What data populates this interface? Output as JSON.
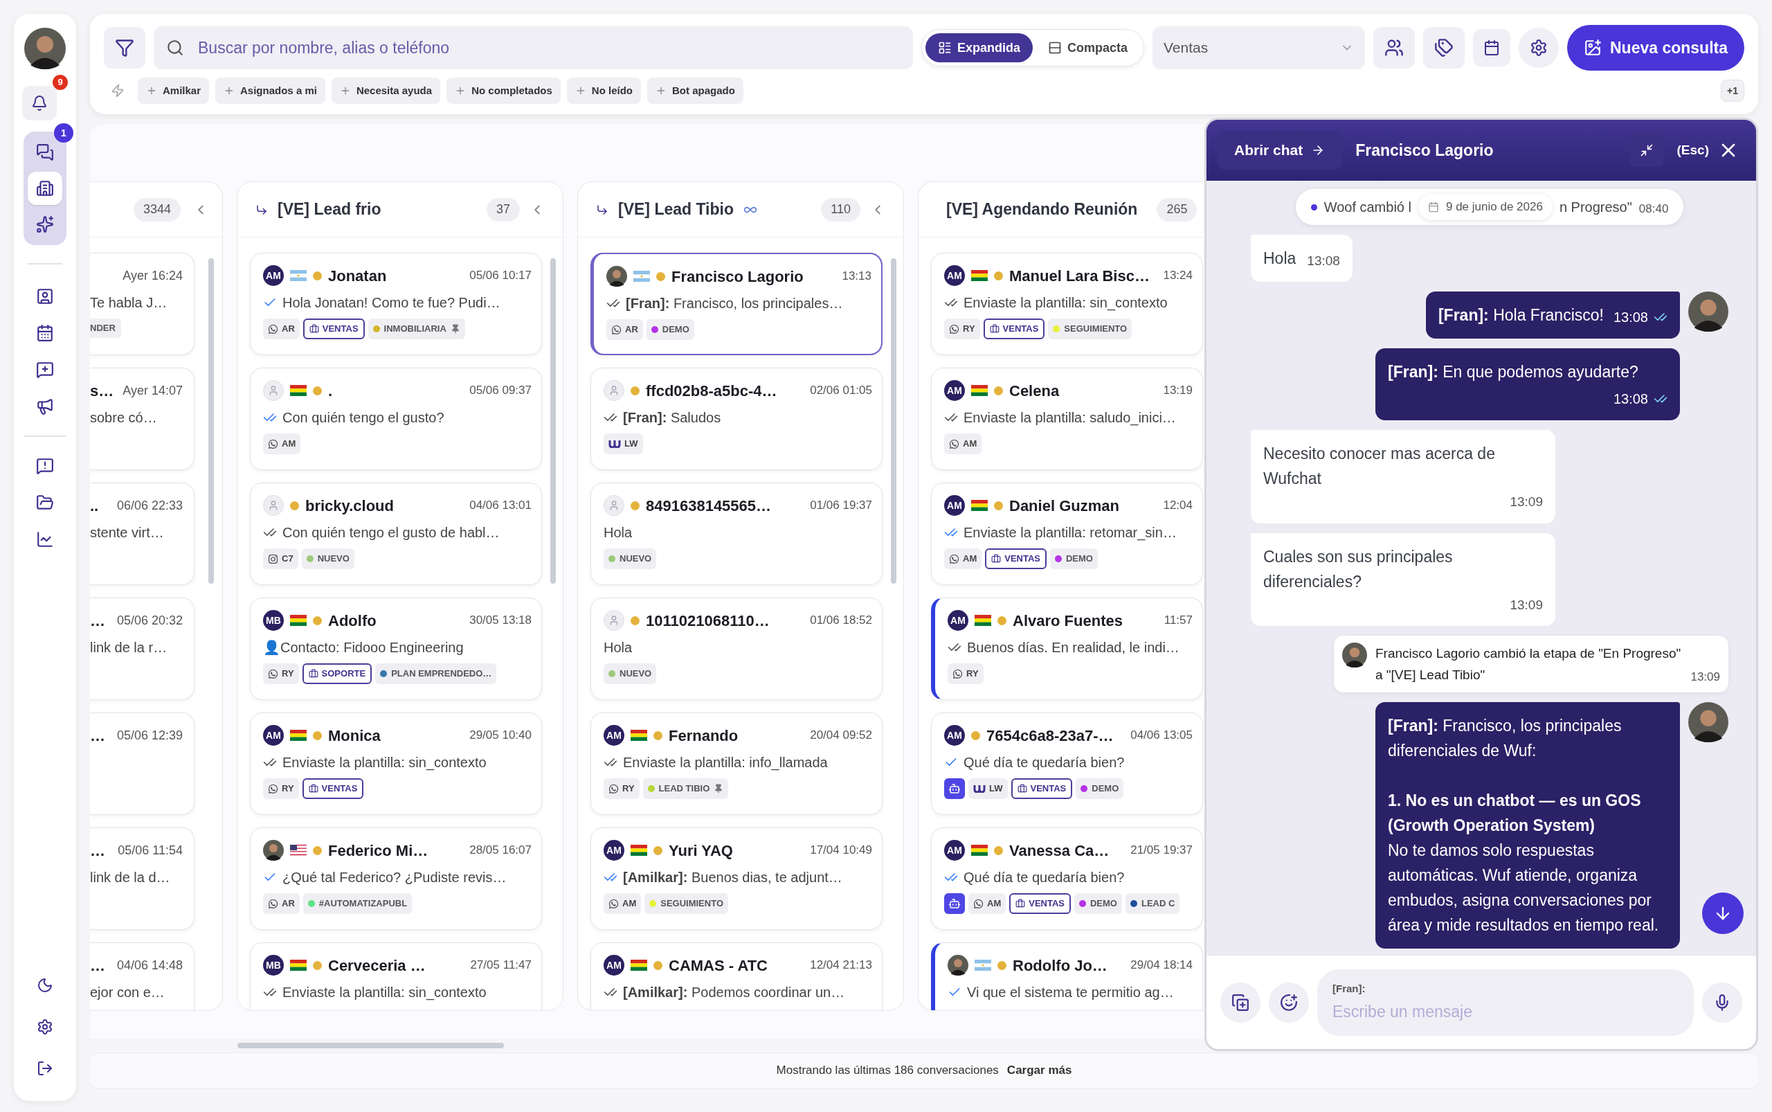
{
  "sidebar": {
    "bell_badge": "9",
    "groups": [
      {
        "kind": "active",
        "items": [
          {
            "selected": false,
            "badge": "1"
          },
          {
            "selected": true
          },
          {
            "selected": false
          }
        ]
      },
      {
        "kind": "plain",
        "items": [
          {
            "selected": false
          },
          {
            "selected": false
          },
          {
            "selected": false
          },
          {
            "selected": false
          }
        ]
      },
      {
        "kind": "plain",
        "items": [
          {
            "selected": false
          },
          {
            "selected": false
          },
          {
            "selected": false
          }
        ]
      }
    ]
  },
  "topbar": {
    "search": {
      "placeholder": "Buscar por nombre, alias o teléfono"
    },
    "view_modes": [
      {
        "label": "Expandida",
        "selected": true
      },
      {
        "label": "Compacta",
        "selected": false
      }
    ],
    "pipeline_select": {
      "value": "Ventas"
    },
    "new_button": "Nueva consulta",
    "quick_filters": [
      "Amilkar",
      "Asignados a mi",
      "Necesita ayuda",
      "No completados",
      "No leído",
      "Bot apagado"
    ],
    "more_badge": "+1"
  },
  "columns": [
    {
      "kind": "partial",
      "count": "3344",
      "collapsible": true,
      "cards": [
        {
          "time": "Ayer 16:24",
          "message": "Te habla J…",
          "tags": [
            {
              "kind": "plain",
              "text": "NDER"
            }
          ]
        },
        {
          "name": "s…",
          "time": "Ayer 14:07",
          "message": "sobre có…"
        },
        {
          "name": "..",
          "time": "06/06 22:33",
          "message": "stente virt…"
        },
        {
          "name": "…",
          "time": "05/06 20:32",
          "message": "link de la r…"
        },
        {
          "name": "…",
          "time": "05/06 12:39"
        },
        {
          "name": "…",
          "time": "05/06 11:54",
          "message": "link de la d…"
        },
        {
          "name": "…",
          "time": "04/06 14:48",
          "message": "ejor con e…"
        }
      ]
    },
    {
      "kind": "stage",
      "title": "[VE] Lead frio",
      "integration_icon": false,
      "count": "37",
      "collapsible": true,
      "cards": [
        {
          "avatar": {
            "kind": "initials",
            "text": "AM"
          },
          "flag": {
            "kind": "ar"
          },
          "name": "Jonatan",
          "time": "05/06 10:17",
          "receipt": {
            "kind": "sent"
          },
          "message": "Hola Jonatan! Como te fue? Pudi…",
          "selected": false,
          "accent_bar": false,
          "tags": [
            {
              "kind": "whatsapp",
              "text": "AR"
            },
            {
              "kind": "area",
              "text": "VENTAS"
            },
            {
              "kind": "label",
              "text": "INMOBILIARIA",
              "color": "#d4b52c",
              "pinned": true
            }
          ]
        },
        {
          "avatar": {
            "kind": "placeholder"
          },
          "flag": {
            "kind": "bo"
          },
          "name": ".",
          "time": "05/06 09:37",
          "receipt": {
            "kind": "read"
          },
          "message": "Con quién tengo el gusto?",
          "selected": false,
          "accent_bar": false,
          "tags": [
            {
              "kind": "whatsapp",
              "text": "AM"
            }
          ]
        },
        {
          "avatar": {
            "kind": "placeholder"
          },
          "name": "bricky.cloud",
          "time": "04/06 13:01",
          "receipt": {
            "kind": "delivered"
          },
          "message": "Con quién tengo el gusto de habl…",
          "selected": false,
          "accent_bar": false,
          "tags": [
            {
              "kind": "instagram",
              "text": "C7"
            },
            {
              "kind": "label",
              "text": "NUEVO",
              "color": "#9cc97a",
              "pinned": false
            }
          ]
        },
        {
          "avatar": {
            "kind": "initials",
            "text": "MB"
          },
          "flag": {
            "kind": "bo"
          },
          "name": "Adolfo",
          "time": "30/05 13:18",
          "message": "👤Contacto: Fidooo Engineering",
          "selected": false,
          "accent_bar": false,
          "tags": [
            {
              "kind": "whatsapp",
              "text": "RY"
            },
            {
              "kind": "area",
              "text": "SOPORTE"
            },
            {
              "kind": "label",
              "text": "PLAN EMPRENDEDO…",
              "color": "#3a78a8",
              "pinned": false
            }
          ]
        },
        {
          "avatar": {
            "kind": "initials",
            "text": "AM"
          },
          "flag": {
            "kind": "bo"
          },
          "name": "Monica",
          "time": "29/05 10:40",
          "receipt": {
            "kind": "delivered"
          },
          "message": "Enviaste la plantilla: sin_contexto",
          "selected": false,
          "accent_bar": false,
          "tags": [
            {
              "kind": "whatsapp",
              "text": "RY"
            },
            {
              "kind": "area",
              "text": "VENTAS"
            }
          ]
        },
        {
          "avatar": {
            "kind": "photo"
          },
          "flag": {
            "kind": "us"
          },
          "name": "Federico Mi…",
          "time": "28/05 16:07",
          "receipt": {
            "kind": "sent"
          },
          "message": "¿Qué tal Federico? ¿Pudiste revis…",
          "selected": false,
          "accent_bar": false,
          "tags": [
            {
              "kind": "whatsapp",
              "text": "AR"
            },
            {
              "kind": "label",
              "text": "#AUTOMATIZAPUBL",
              "color": "#5ee38a",
              "pinned": false
            }
          ]
        },
        {
          "avatar": {
            "kind": "initials",
            "text": "MB"
          },
          "flag": {
            "kind": "bo"
          },
          "name": "Cerveceria …",
          "time": "27/05 11:47",
          "receipt": {
            "kind": "delivered"
          },
          "message": "Enviaste la plantilla: sin_contexto",
          "selected": false,
          "accent_bar": false
        }
      ]
    },
    {
      "kind": "stage",
      "title": "[VE] Lead Tibio",
      "integration_icon": true,
      "count": "110",
      "collapsible": true,
      "cards": [
        {
          "avatar": {
            "kind": "photo"
          },
          "flag": {
            "kind": "ar"
          },
          "name": "Francisco Lagorio",
          "time": "13:13",
          "receipt": {
            "kind": "delivered"
          },
          "message": "**[Fran]:** Francisco, los principales…",
          "selected": true,
          "accent_bar": false,
          "tags": [
            {
              "kind": "whatsapp",
              "text": "AR"
            },
            {
              "kind": "label",
              "text": "DEMO",
              "color": "#b532e6",
              "pinned": false
            }
          ]
        },
        {
          "avatar": {
            "kind": "placeholder"
          },
          "name": "ffcd02b8-a5bc-4…",
          "time": "02/06 01:05",
          "receipt": {
            "kind": "delivered"
          },
          "message": "**[Fran]:** Saludos",
          "selected": false,
          "accent_bar": false,
          "tags": [
            {
              "kind": "web",
              "text": "LW"
            }
          ]
        },
        {
          "avatar": {
            "kind": "placeholder"
          },
          "name": "8491638145565…",
          "time": "01/06 19:37",
          "message": "Hola",
          "selected": false,
          "accent_bar": false,
          "tags": [
            {
              "kind": "label",
              "text": "NUEVO",
              "color": "#9cc97a",
              "pinned": false
            }
          ]
        },
        {
          "avatar": {
            "kind": "placeholder"
          },
          "name": "1011021068110…",
          "time": "01/06 18:52",
          "message": "Hola",
          "selected": false,
          "accent_bar": false,
          "tags": [
            {
              "kind": "label",
              "text": "NUEVO",
              "color": "#9cc97a",
              "pinned": false
            }
          ]
        },
        {
          "avatar": {
            "kind": "initials",
            "text": "AM"
          },
          "flag": {
            "kind": "bo"
          },
          "name": "Fernando",
          "time": "20/04 09:52",
          "receipt": {
            "kind": "delivered"
          },
          "message": "Enviaste la plantilla: info_llamada",
          "selected": false,
          "accent_bar": false,
          "tags": [
            {
              "kind": "whatsapp",
              "text": "RY"
            },
            {
              "kind": "label",
              "text": "LEAD TIBIO",
              "color": "#b9d736",
              "pinned": true
            }
          ]
        },
        {
          "avatar": {
            "kind": "initials",
            "text": "AM"
          },
          "flag": {
            "kind": "bo"
          },
          "name": "Yuri YAQ",
          "time": "17/04 10:49",
          "receipt": {
            "kind": "read"
          },
          "message": "**[Amilkar]:** Buenos dias, te adjunt…",
          "selected": false,
          "accent_bar": false,
          "tags": [
            {
              "kind": "whatsapp",
              "text": "AM"
            },
            {
              "kind": "label",
              "text": "SEGUIMIENTO",
              "color": "#e6f23c",
              "pinned": false
            }
          ]
        },
        {
          "avatar": {
            "kind": "initials",
            "text": "AM"
          },
          "flag": {
            "kind": "bo"
          },
          "name": "CAMAS - ATC",
          "time": "12/04 21:13",
          "receipt": {
            "kind": "delivered"
          },
          "message": "**[Amilkar]:** Podemos coordinar un…",
          "selected": false,
          "accent_bar": false
        }
      ]
    },
    {
      "kind": "stage",
      "title": "[VE] Agendando Reunión",
      "integration_icon": false,
      "count": "265",
      "collapsible": false,
      "cards": [
        {
          "avatar": {
            "kind": "initials",
            "text": "AM"
          },
          "flag": {
            "kind": "bo"
          },
          "name": "Manuel Lara Bisc…",
          "time": "13:24",
          "receipt": {
            "kind": "delivered"
          },
          "message": "Enviaste la plantilla: sin_contexto",
          "selected": false,
          "accent_bar": false,
          "tags": [
            {
              "kind": "whatsapp",
              "text": "RY"
            },
            {
              "kind": "area",
              "text": "VENTAS"
            },
            {
              "kind": "label",
              "text": "SEGUIMIENTO",
              "color": "#e6f23c",
              "pinned": false
            }
          ]
        },
        {
          "avatar": {
            "kind": "initials",
            "text": "AM"
          },
          "flag": {
            "kind": "bo"
          },
          "name": "Celena",
          "time": "13:19",
          "receipt": {
            "kind": "delivered"
          },
          "message": "Enviaste la plantilla: saludo_inici…",
          "selected": false,
          "accent_bar": false,
          "tags": [
            {
              "kind": "whatsapp",
              "text": "AM"
            }
          ]
        },
        {
          "avatar": {
            "kind": "initials",
            "text": "AM"
          },
          "flag": {
            "kind": "bo"
          },
          "name": "Daniel Guzman",
          "time": "12:04",
          "receipt": {
            "kind": "read"
          },
          "message": "Enviaste la plantilla: retomar_sin…",
          "selected": false,
          "accent_bar": false,
          "tags": [
            {
              "kind": "whatsapp",
              "text": "AM"
            },
            {
              "kind": "area",
              "text": "VENTAS"
            },
            {
              "kind": "label",
              "text": "DEMO",
              "color": "#b532e6",
              "pinned": false
            }
          ]
        },
        {
          "avatar": {
            "kind": "initials",
            "text": "AM"
          },
          "flag": {
            "kind": "bo"
          },
          "name": "Alvaro Fuentes",
          "time": "11:57",
          "receipt": {
            "kind": "delivered"
          },
          "message": "Buenos días. En realidad, le indi…",
          "selected": false,
          "accent_bar": true,
          "tags": [
            {
              "kind": "whatsapp",
              "text": "RY"
            }
          ]
        },
        {
          "avatar": {
            "kind": "initials",
            "text": "AM"
          },
          "name": "7654c6a8-23a7-…",
          "time": "04/06 13:05",
          "receipt": {
            "kind": "sent"
          },
          "message": "Qué día te quedaría bien?",
          "selected": false,
          "accent_bar": false,
          "tags": [
            {
              "kind": "bot"
            },
            {
              "kind": "web",
              "text": "LW"
            },
            {
              "kind": "area",
              "text": "VENTAS"
            },
            {
              "kind": "label",
              "text": "DEMO",
              "color": "#b532e6",
              "pinned": false
            }
          ]
        },
        {
          "avatar": {
            "kind": "initials",
            "text": "AM"
          },
          "flag": {
            "kind": "bo"
          },
          "name": "Vanessa Ca…",
          "time": "21/05 19:37",
          "receipt": {
            "kind": "read"
          },
          "message": "Qué día te quedaría bien?",
          "selected": false,
          "accent_bar": false,
          "tags": [
            {
              "kind": "bot"
            },
            {
              "kind": "whatsapp",
              "text": "AM"
            },
            {
              "kind": "area",
              "text": "VENTAS"
            },
            {
              "kind": "label",
              "text": "DEMO",
              "color": "#b532e6",
              "pinned": false
            },
            {
              "kind": "label",
              "text": "LEAD C",
              "color": "#1f4e9c",
              "pinned": false
            }
          ]
        },
        {
          "avatar": {
            "kind": "photo"
          },
          "flag": {
            "kind": "ar"
          },
          "name": "Rodolfo Jo…",
          "time": "29/04 18:14",
          "receipt": {
            "kind": "sent"
          },
          "message": "Vi que el sistema te permitio ag…",
          "selected": false,
          "accent_bar": true
        }
      ]
    }
  ],
  "footer": {
    "text": "Mostrando las últimas 186 conversaciones",
    "link": "Cargar más"
  },
  "chat": {
    "open_button": "Abrir chat",
    "title": "Francisco Lagorio",
    "close_hint": "(Esc)",
    "timeline": [
      {
        "kind": "system",
        "text_before": "Woof cambió l",
        "date": "9 de junio de 2026",
        "text_after": "n Progreso\"",
        "time": "08:40"
      },
      {
        "kind": "incoming",
        "text": "Hola",
        "time": "13:08"
      },
      {
        "kind": "outgoing",
        "text": "**[Fran]:** Hola Francisco!",
        "time": "13:08",
        "receipt": {
          "kind": "read"
        },
        "avatar": true
      },
      {
        "kind": "outgoing",
        "text": "**[Fran]:** En que podemos ayudarte?",
        "time": "13:08",
        "receipt": {
          "kind": "read"
        },
        "avatar": false
      },
      {
        "kind": "incoming",
        "text": "Necesito conocer mas acerca de Wufchat",
        "time": "13:09"
      },
      {
        "kind": "incoming",
        "text": "Cuales son sus principales diferenciales?",
        "time": "13:09"
      },
      {
        "kind": "event",
        "text": "Francisco Lagorio cambió la etapa de \"En Progreso\" a \"[VE] Lead Tibio\"",
        "time": "13:09"
      },
      {
        "kind": "outgoing",
        "text": "**[Fran]:** Francisco, los principales diferenciales de Wuf:\n\n**1. No es un chatbot — es un GOS (Growth Operation System)**\nNo te damos solo respuestas automáticas. Wuf atiende, organiza embudos, asigna conversaciones por área y mide resultados en tiempo real.",
        "avatar": true
      }
    ],
    "composer": {
      "sender": "[Fran]:",
      "placeholder": "Escribe un mensaje"
    }
  }
}
